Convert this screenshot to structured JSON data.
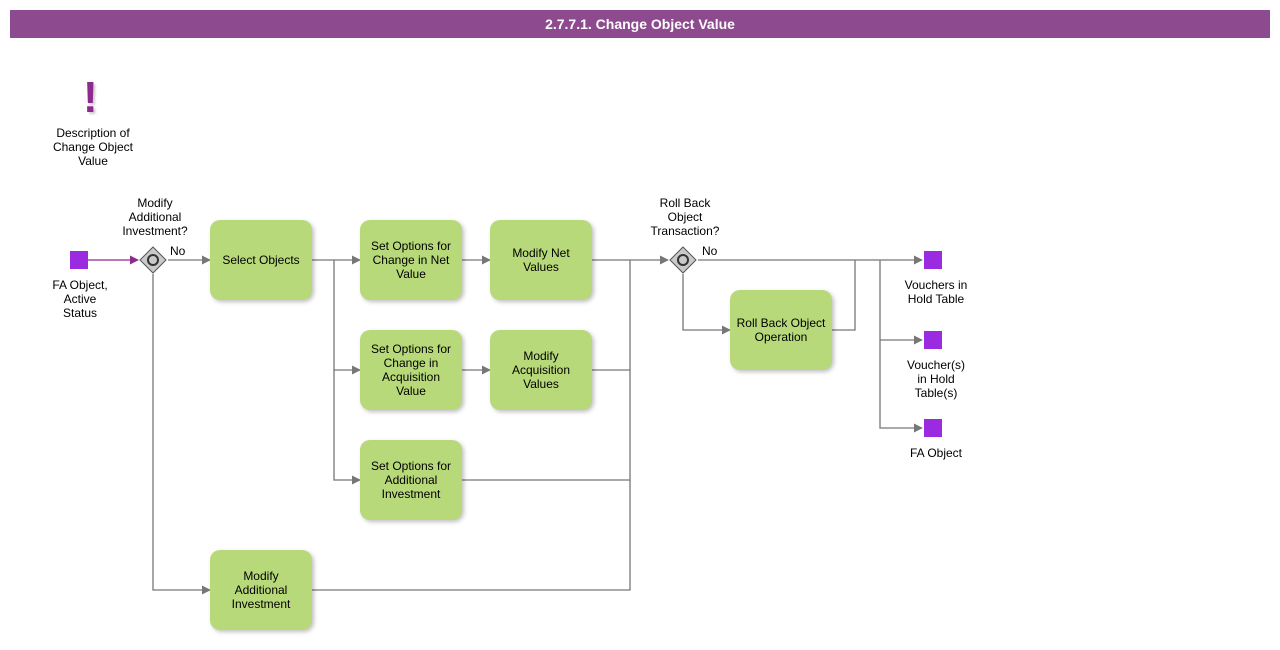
{
  "header": {
    "title": "2.7.7.1. Change Object Value"
  },
  "annotation": {
    "excl": "!",
    "caption": "Description of\nChange Object\nValue"
  },
  "start": {
    "label": "FA Object,\nActive\nStatus"
  },
  "gateways": {
    "modify": {
      "question": "Modify\nAdditional\nInvestment?",
      "path_no": "No"
    },
    "rollback": {
      "question": "Roll Back\nObject\nTransaction?",
      "path_no": "No"
    }
  },
  "activities": {
    "select_objects": "Select Objects",
    "set_net": "Set Options for\nChange in Net\nValue",
    "modify_net": "Modify Net\nValues",
    "set_acq": "Set Options for\nChange in\nAcquisition\nValue",
    "modify_acq": "Modify\nAcquisition\nValues",
    "set_addl": "Set Options for\nAdditional\nInvestment",
    "modify_addl": "Modify\nAdditional\nInvestment",
    "rollback_op": "Roll Back Object\nOperation"
  },
  "ends": {
    "vouchers": "Vouchers in\nHold Table",
    "vouchers2": "Voucher(s)\nin Hold\nTable(s)",
    "fa_object": "FA Object"
  }
}
